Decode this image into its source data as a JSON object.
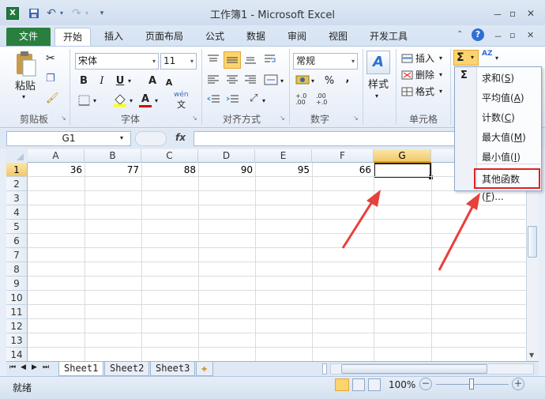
{
  "window": {
    "title": "工作簿1 - Microsoft Excel",
    "minimize": "－",
    "restore": "▫",
    "close": "✕"
  },
  "qat": {
    "excel_icon": "X",
    "save_icon": "save-icon",
    "undo": "↶",
    "redo": "↷",
    "customize": "▾"
  },
  "tabs": [
    "文件",
    "开始",
    "插入",
    "页面布局",
    "公式",
    "数据",
    "审阅",
    "视图",
    "开发工具"
  ],
  "ribbon": {
    "clipboard": {
      "paste": "粘贴",
      "label": "剪贴板"
    },
    "font": {
      "name": "宋体",
      "size": "11",
      "bold": "B",
      "italic": "I",
      "underline": "U",
      "grow": "A",
      "shrink": "A",
      "color_letter": "A",
      "wen": "wén",
      "wen2": "文",
      "label": "字体"
    },
    "alignment": {
      "label": "对齐方式"
    },
    "number": {
      "format": "常规",
      "percent": "%",
      "comma": ",",
      "dec_inc": "+.0 .00",
      "dec_dec": ".00 +.0",
      "label": "数字"
    },
    "styles": {
      "label": "样式"
    },
    "cells": {
      "insert": "插入",
      "delete": "删除",
      "format": "格式",
      "label": "单元格"
    },
    "editing": {
      "sigma": "Σ",
      "sort": "AZ"
    }
  },
  "formula_bar": {
    "name_box": "G1",
    "fx": "fx",
    "value": ""
  },
  "columns": [
    "A",
    "B",
    "C",
    "D",
    "E",
    "F",
    "G"
  ],
  "rows": [
    "1",
    "2",
    "3",
    "4",
    "5",
    "6",
    "7",
    "8",
    "9",
    "10",
    "11",
    "12",
    "13",
    "14"
  ],
  "cells": {
    "A1": "36",
    "B1": "77",
    "C1": "88",
    "D1": "90",
    "E1": "95",
    "F1": "66"
  },
  "sheets": [
    "Sheet1",
    "Sheet2",
    "Sheet3"
  ],
  "sheet_nav": [
    "⏮",
    "◀",
    "▶",
    "⏭"
  ],
  "status": {
    "ready": "就绪",
    "zoom": "100%",
    "zoom_out": "－",
    "zoom_in": "＋"
  },
  "autosum_menu": {
    "items": [
      {
        "label": "求和",
        "key": "S"
      },
      {
        "label": "平均值",
        "key": "A"
      },
      {
        "label": "计数",
        "key": "C"
      },
      {
        "label": "最大值",
        "key": "M"
      },
      {
        "label": "最小值",
        "key": "I"
      },
      {
        "label": "其他函数",
        "key": "F",
        "suffix": "..."
      }
    ]
  },
  "colors": {
    "file_tab": "#2a7f3f",
    "selection": "#f2c86b",
    "highlight_box": "#e02020",
    "arrow": "#e8403a"
  }
}
